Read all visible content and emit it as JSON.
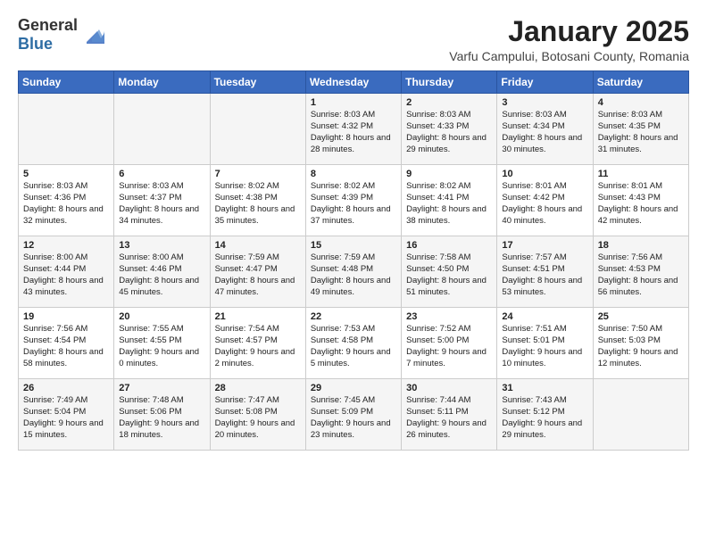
{
  "logo": {
    "general": "General",
    "blue": "Blue"
  },
  "title": "January 2025",
  "subtitle": "Varfu Campului, Botosani County, Romania",
  "days_of_week": [
    "Sunday",
    "Monday",
    "Tuesday",
    "Wednesday",
    "Thursday",
    "Friday",
    "Saturday"
  ],
  "weeks": [
    [
      {
        "day": "",
        "info": ""
      },
      {
        "day": "",
        "info": ""
      },
      {
        "day": "",
        "info": ""
      },
      {
        "day": "1",
        "info": "Sunrise: 8:03 AM\nSunset: 4:32 PM\nDaylight: 8 hours and 28 minutes."
      },
      {
        "day": "2",
        "info": "Sunrise: 8:03 AM\nSunset: 4:33 PM\nDaylight: 8 hours and 29 minutes."
      },
      {
        "day": "3",
        "info": "Sunrise: 8:03 AM\nSunset: 4:34 PM\nDaylight: 8 hours and 30 minutes."
      },
      {
        "day": "4",
        "info": "Sunrise: 8:03 AM\nSunset: 4:35 PM\nDaylight: 8 hours and 31 minutes."
      }
    ],
    [
      {
        "day": "5",
        "info": "Sunrise: 8:03 AM\nSunset: 4:36 PM\nDaylight: 8 hours and 32 minutes."
      },
      {
        "day": "6",
        "info": "Sunrise: 8:03 AM\nSunset: 4:37 PM\nDaylight: 8 hours and 34 minutes."
      },
      {
        "day": "7",
        "info": "Sunrise: 8:02 AM\nSunset: 4:38 PM\nDaylight: 8 hours and 35 minutes."
      },
      {
        "day": "8",
        "info": "Sunrise: 8:02 AM\nSunset: 4:39 PM\nDaylight: 8 hours and 37 minutes."
      },
      {
        "day": "9",
        "info": "Sunrise: 8:02 AM\nSunset: 4:41 PM\nDaylight: 8 hours and 38 minutes."
      },
      {
        "day": "10",
        "info": "Sunrise: 8:01 AM\nSunset: 4:42 PM\nDaylight: 8 hours and 40 minutes."
      },
      {
        "day": "11",
        "info": "Sunrise: 8:01 AM\nSunset: 4:43 PM\nDaylight: 8 hours and 42 minutes."
      }
    ],
    [
      {
        "day": "12",
        "info": "Sunrise: 8:00 AM\nSunset: 4:44 PM\nDaylight: 8 hours and 43 minutes."
      },
      {
        "day": "13",
        "info": "Sunrise: 8:00 AM\nSunset: 4:46 PM\nDaylight: 8 hours and 45 minutes."
      },
      {
        "day": "14",
        "info": "Sunrise: 7:59 AM\nSunset: 4:47 PM\nDaylight: 8 hours and 47 minutes."
      },
      {
        "day": "15",
        "info": "Sunrise: 7:59 AM\nSunset: 4:48 PM\nDaylight: 8 hours and 49 minutes."
      },
      {
        "day": "16",
        "info": "Sunrise: 7:58 AM\nSunset: 4:50 PM\nDaylight: 8 hours and 51 minutes."
      },
      {
        "day": "17",
        "info": "Sunrise: 7:57 AM\nSunset: 4:51 PM\nDaylight: 8 hours and 53 minutes."
      },
      {
        "day": "18",
        "info": "Sunrise: 7:56 AM\nSunset: 4:53 PM\nDaylight: 8 hours and 56 minutes."
      }
    ],
    [
      {
        "day": "19",
        "info": "Sunrise: 7:56 AM\nSunset: 4:54 PM\nDaylight: 8 hours and 58 minutes."
      },
      {
        "day": "20",
        "info": "Sunrise: 7:55 AM\nSunset: 4:55 PM\nDaylight: 9 hours and 0 minutes."
      },
      {
        "day": "21",
        "info": "Sunrise: 7:54 AM\nSunset: 4:57 PM\nDaylight: 9 hours and 2 minutes."
      },
      {
        "day": "22",
        "info": "Sunrise: 7:53 AM\nSunset: 4:58 PM\nDaylight: 9 hours and 5 minutes."
      },
      {
        "day": "23",
        "info": "Sunrise: 7:52 AM\nSunset: 5:00 PM\nDaylight: 9 hours and 7 minutes."
      },
      {
        "day": "24",
        "info": "Sunrise: 7:51 AM\nSunset: 5:01 PM\nDaylight: 9 hours and 10 minutes."
      },
      {
        "day": "25",
        "info": "Sunrise: 7:50 AM\nSunset: 5:03 PM\nDaylight: 9 hours and 12 minutes."
      }
    ],
    [
      {
        "day": "26",
        "info": "Sunrise: 7:49 AM\nSunset: 5:04 PM\nDaylight: 9 hours and 15 minutes."
      },
      {
        "day": "27",
        "info": "Sunrise: 7:48 AM\nSunset: 5:06 PM\nDaylight: 9 hours and 18 minutes."
      },
      {
        "day": "28",
        "info": "Sunrise: 7:47 AM\nSunset: 5:08 PM\nDaylight: 9 hours and 20 minutes."
      },
      {
        "day": "29",
        "info": "Sunrise: 7:45 AM\nSunset: 5:09 PM\nDaylight: 9 hours and 23 minutes."
      },
      {
        "day": "30",
        "info": "Sunrise: 7:44 AM\nSunset: 5:11 PM\nDaylight: 9 hours and 26 minutes."
      },
      {
        "day": "31",
        "info": "Sunrise: 7:43 AM\nSunset: 5:12 PM\nDaylight: 9 hours and 29 minutes."
      },
      {
        "day": "",
        "info": ""
      }
    ]
  ]
}
